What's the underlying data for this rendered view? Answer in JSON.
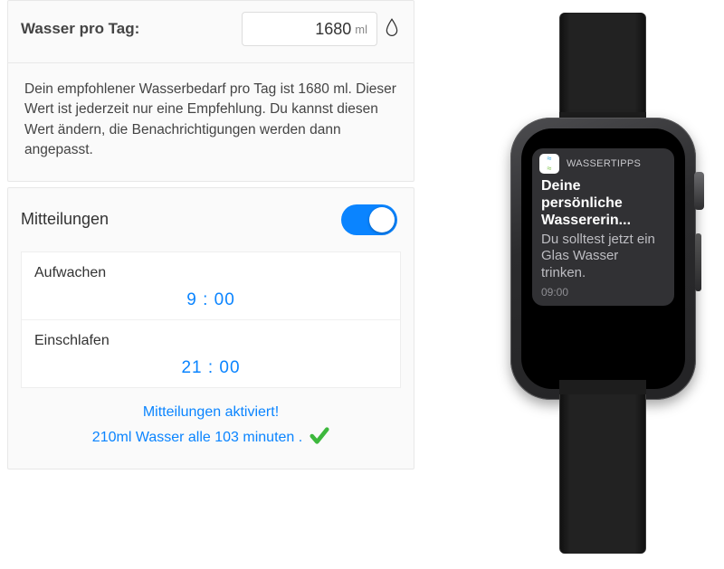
{
  "settings": {
    "water": {
      "label": "Wasser pro Tag:",
      "value": "1680",
      "unit": "ml"
    },
    "advice": "Dein empfohlener Wasserbedarf pro Tag ist 1680 ml. Dieser Wert ist jederzeit nur eine Empfehlung. Du kannst diesen Wert ändern, die Benachrichtigungen werden dann angepasst.",
    "notifications": {
      "title": "Mitteilungen",
      "enabled": true,
      "wake_label": "Aufwachen",
      "wake_time": "9 : 00",
      "sleep_label": "Einschlafen",
      "sleep_time": "21 : 00",
      "status_activated": "Mitteilungen aktiviert!",
      "status_detail": "210ml Wasser alle 103 minuten ."
    }
  },
  "watch": {
    "app_name": "WASSERTIPPS",
    "title": "Deine persönliche Wassererin...",
    "message": "Du solltest jetzt ein Glas Wasser trinken.",
    "time": "09:00"
  }
}
